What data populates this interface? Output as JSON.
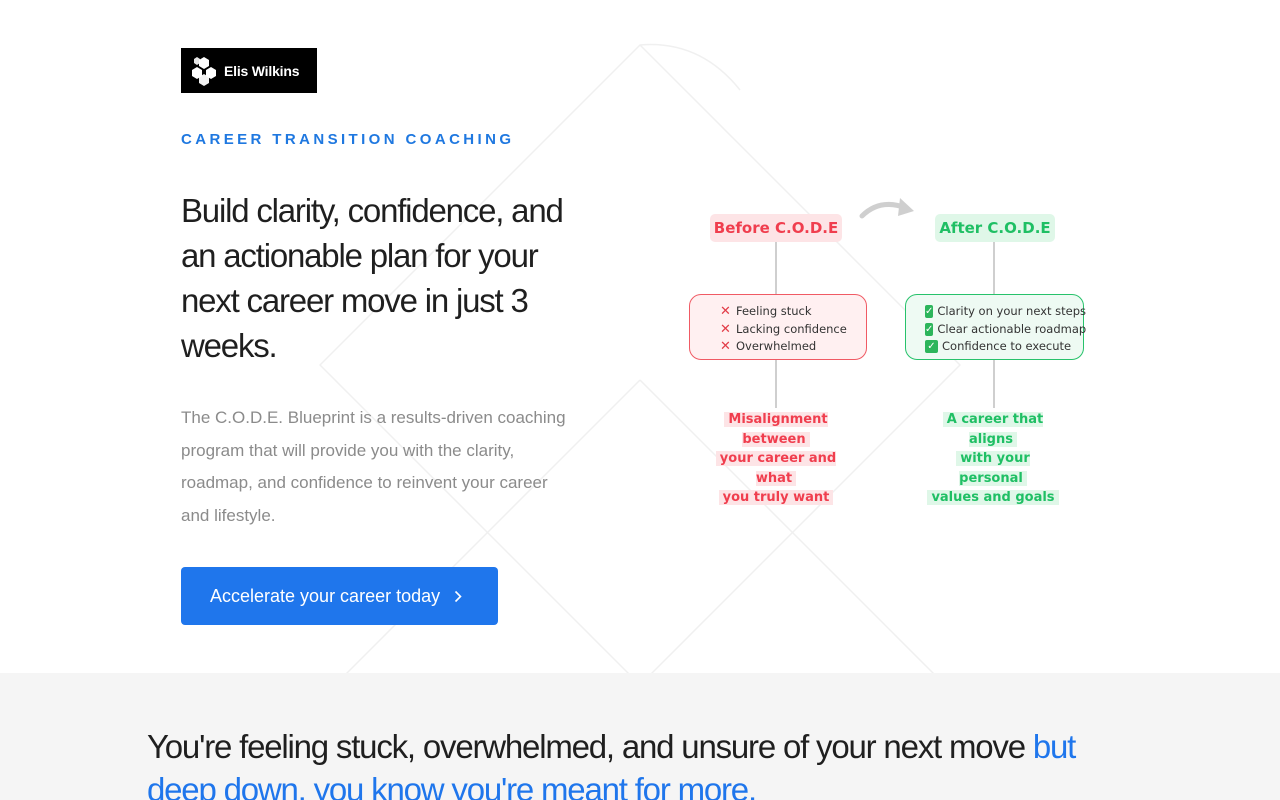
{
  "brand": {
    "name": "Elis Wilkins",
    "logo_icon": "hexagon-cluster-icon"
  },
  "hero": {
    "eyebrow": "CAREER TRANSITION COACHING",
    "headline": "Build clarity, confidence, and an actionable plan for your next career move in just 3 weeks.",
    "description": "The C.O.D.E. Blueprint is a results-driven coaching program that will provide you with the clarity, roadmap, and confidence to reinvent your career and lifestyle.",
    "cta_label": "Accelerate your career today",
    "cta_icon": "chevron-right-icon"
  },
  "diagram": {
    "before": {
      "label": "Before C.O.D.E",
      "items": [
        "Feeling stuck",
        "Lacking confidence",
        "Overwhelmed"
      ],
      "outcome": [
        "Misalignment between",
        "your career and what",
        "you truly want"
      ]
    },
    "after": {
      "label": "After C.O.D.E",
      "items": [
        "Clarity on your next steps",
        "Clear actionable roadmap",
        "Confidence to execute"
      ],
      "outcome": [
        "A career that aligns",
        "with your personal",
        "values and goals"
      ]
    },
    "colors": {
      "before": "#f03e4e",
      "after": "#1fbf64"
    }
  },
  "problem": {
    "text_main": "You're feeling stuck, overwhelmed, and unsure of your next move ",
    "text_highlight": "but deep down, you know you're meant for more."
  },
  "colors": {
    "accent": "#1f76ec",
    "eyebrow": "#1f78e0"
  }
}
